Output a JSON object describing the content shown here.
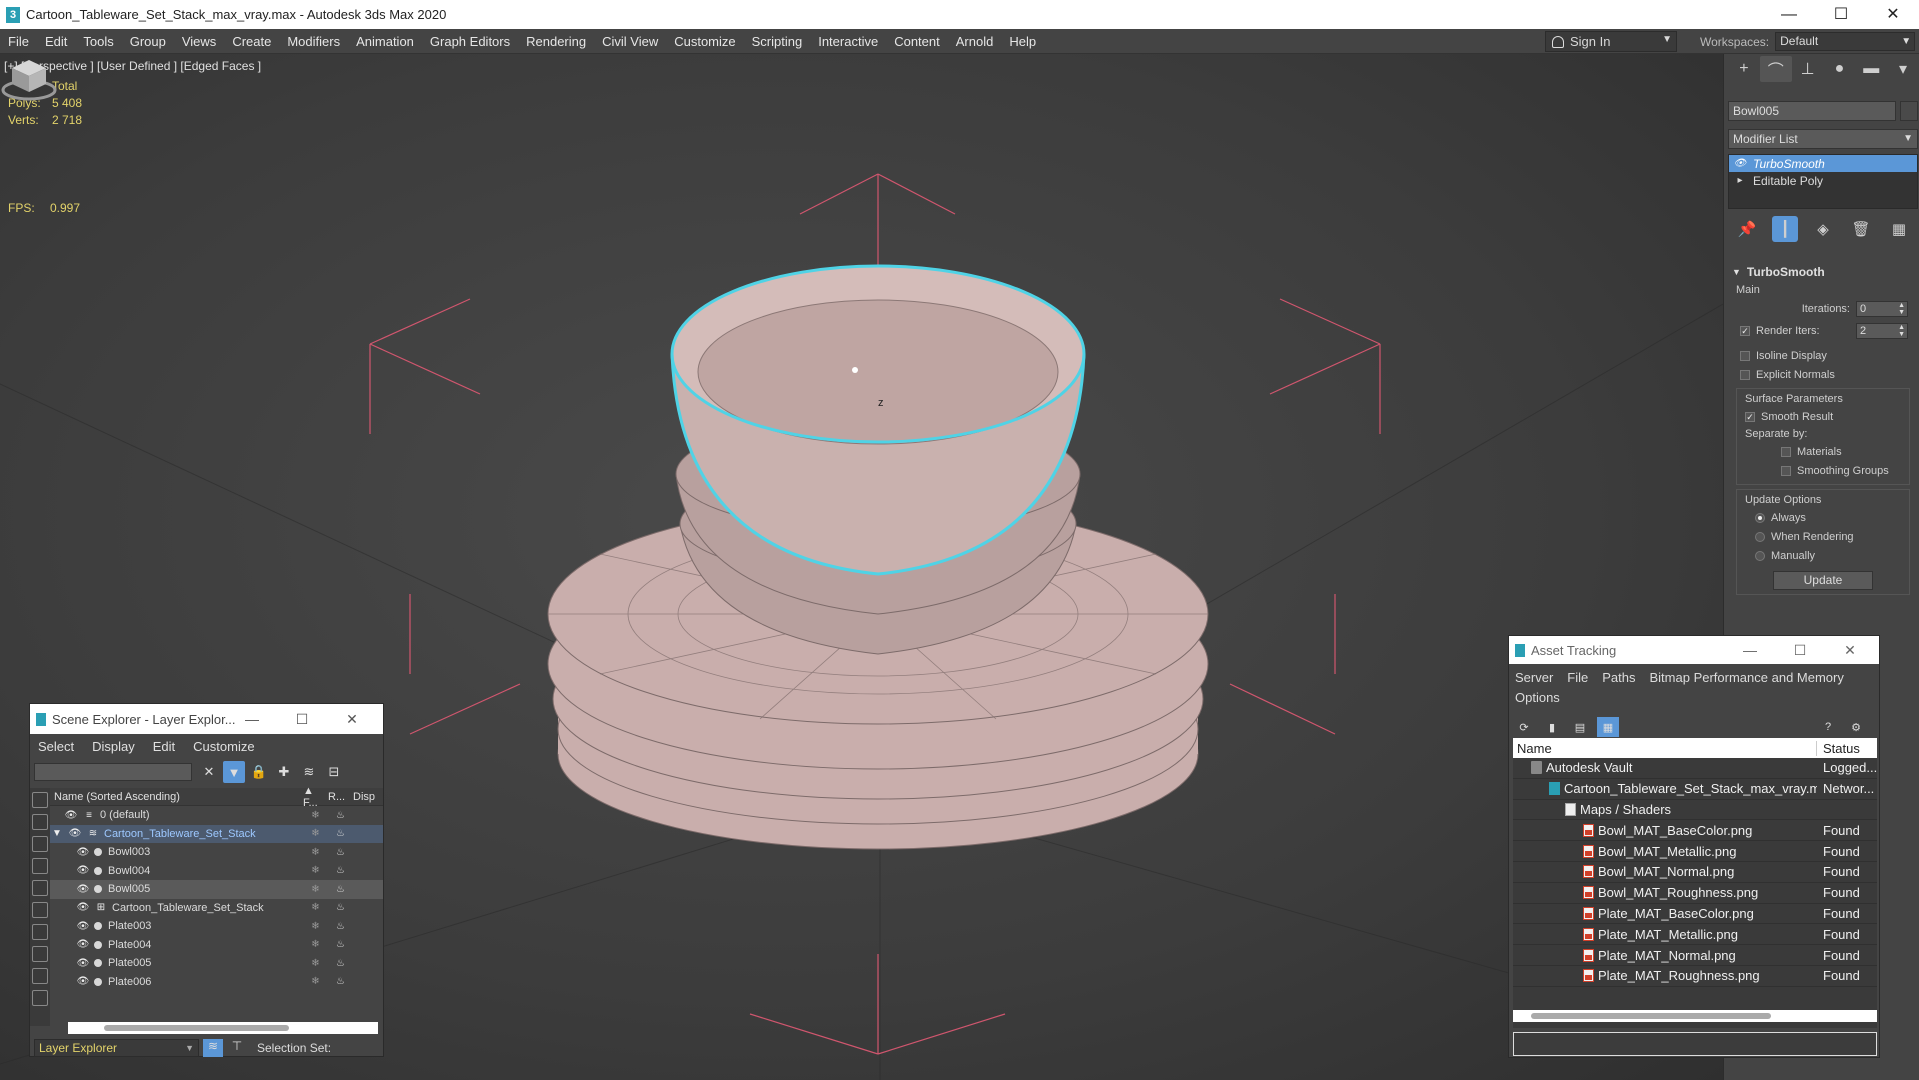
{
  "window": {
    "title": "Cartoon_Tableware_Set_Stack_max_vray.max - Autodesk 3ds Max 2020",
    "app_icon_letter": "3",
    "minimize": "—",
    "maximize": "☐",
    "close": "✕"
  },
  "menubar": {
    "items": [
      "File",
      "Edit",
      "Tools",
      "Group",
      "Views",
      "Create",
      "Modifiers",
      "Animation",
      "Graph Editors",
      "Rendering",
      "Civil View",
      "Customize",
      "Scripting",
      "Interactive",
      "Content",
      "Arnold",
      "Help"
    ],
    "sign_in": "Sign In",
    "workspaces_label": "Workspaces:",
    "workspace_value": "Default"
  },
  "viewport": {
    "label": "[+] [Perspective ] [User Defined ] [Edged Faces ]",
    "stats_header": "Total",
    "polys_label": "Polys:",
    "polys_value": "5 408",
    "verts_label": "Verts:",
    "verts_value": "2 718",
    "fps_label": "FPS:",
    "fps_value": "0.997",
    "axis_label": "z"
  },
  "command_panel": {
    "object_name": "Bowl005",
    "modifier_list": "Modifier List",
    "stack": [
      {
        "label": "TurboSmooth",
        "selected": true
      },
      {
        "label": "Editable Poly",
        "selected": false
      }
    ],
    "rollout_title": "TurboSmooth",
    "main_label": "Main",
    "iterations_label": "Iterations:",
    "iterations_value": "0",
    "render_iters_label": "Render Iters:",
    "render_iters_value": "2",
    "render_iters_checked": true,
    "isoline_label": "Isoline Display",
    "explicit_normals_label": "Explicit Normals",
    "surface_params_label": "Surface Parameters",
    "smooth_result_label": "Smooth Result",
    "separate_by_label": "Separate by:",
    "materials_label": "Materials",
    "smoothing_groups_label": "Smoothing Groups",
    "update_options_label": "Update Options",
    "always_label": "Always",
    "when_rendering_label": "When Rendering",
    "manually_label": "Manually",
    "update_button": "Update"
  },
  "scene_explorer": {
    "title": "Scene Explorer - Layer Explor...",
    "menu": [
      "Select",
      "Display",
      "Edit",
      "Customize"
    ],
    "col_name": "Name (Sorted Ascending)",
    "col_f": "▲ F...",
    "col_r": "R...",
    "col_disp": "Disp",
    "rows": [
      {
        "name": "0 (default)",
        "indent": 1,
        "kind": "layer"
      },
      {
        "name": "Cartoon_Tableware_Set_Stack",
        "indent": 0,
        "kind": "layer-selected"
      },
      {
        "name": "Bowl003",
        "indent": 2,
        "kind": "object"
      },
      {
        "name": "Bowl004",
        "indent": 2,
        "kind": "object"
      },
      {
        "name": "Bowl005",
        "indent": 2,
        "kind": "object-selected"
      },
      {
        "name": "Cartoon_Tableware_Set_Stack",
        "indent": 2,
        "kind": "group"
      },
      {
        "name": "Plate003",
        "indent": 2,
        "kind": "object"
      },
      {
        "name": "Plate004",
        "indent": 2,
        "kind": "object"
      },
      {
        "name": "Plate005",
        "indent": 2,
        "kind": "object"
      },
      {
        "name": "Plate006",
        "indent": 2,
        "kind": "object"
      }
    ],
    "footer_layer": "Layer Explorer",
    "selection_set": "Selection Set:"
  },
  "asset_tracking": {
    "title": "Asset Tracking",
    "menu": [
      "Server",
      "File",
      "Paths",
      "Bitmap Performance and Memory",
      "Options"
    ],
    "col_name": "Name",
    "col_status": "Status",
    "rows": [
      {
        "name": "Autodesk Vault",
        "status": "Logged...",
        "icon": "vault",
        "indent": 1
      },
      {
        "name": "Cartoon_Tableware_Set_Stack_max_vray.max",
        "status": "Networ...",
        "icon": "max",
        "indent": 2
      },
      {
        "name": "Maps / Shaders",
        "status": "",
        "icon": "folder",
        "indent": 3
      },
      {
        "name": "Bowl_MAT_BaseColor.png",
        "status": "Found",
        "icon": "png",
        "indent": 4
      },
      {
        "name": "Bowl_MAT_Metallic.png",
        "status": "Found",
        "icon": "png",
        "indent": 4
      },
      {
        "name": "Bowl_MAT_Normal.png",
        "status": "Found",
        "icon": "png",
        "indent": 4
      },
      {
        "name": "Bowl_MAT_Roughness.png",
        "status": "Found",
        "icon": "png",
        "indent": 4
      },
      {
        "name": "Plate_MAT_BaseColor.png",
        "status": "Found",
        "icon": "png",
        "indent": 4
      },
      {
        "name": "Plate_MAT_Metallic.png",
        "status": "Found",
        "icon": "png",
        "indent": 4
      },
      {
        "name": "Plate_MAT_Normal.png",
        "status": "Found",
        "icon": "png",
        "indent": 4
      },
      {
        "name": "Plate_MAT_Roughness.png",
        "status": "Found",
        "icon": "png",
        "indent": 4
      }
    ]
  },
  "colors": {
    "accent": "#5b97d7",
    "selection_outline": "#4fd3e6",
    "stats_text": "#e3d36a",
    "bbox_lines": "#d0566e",
    "mesh_fill": "#c6aaa8"
  }
}
